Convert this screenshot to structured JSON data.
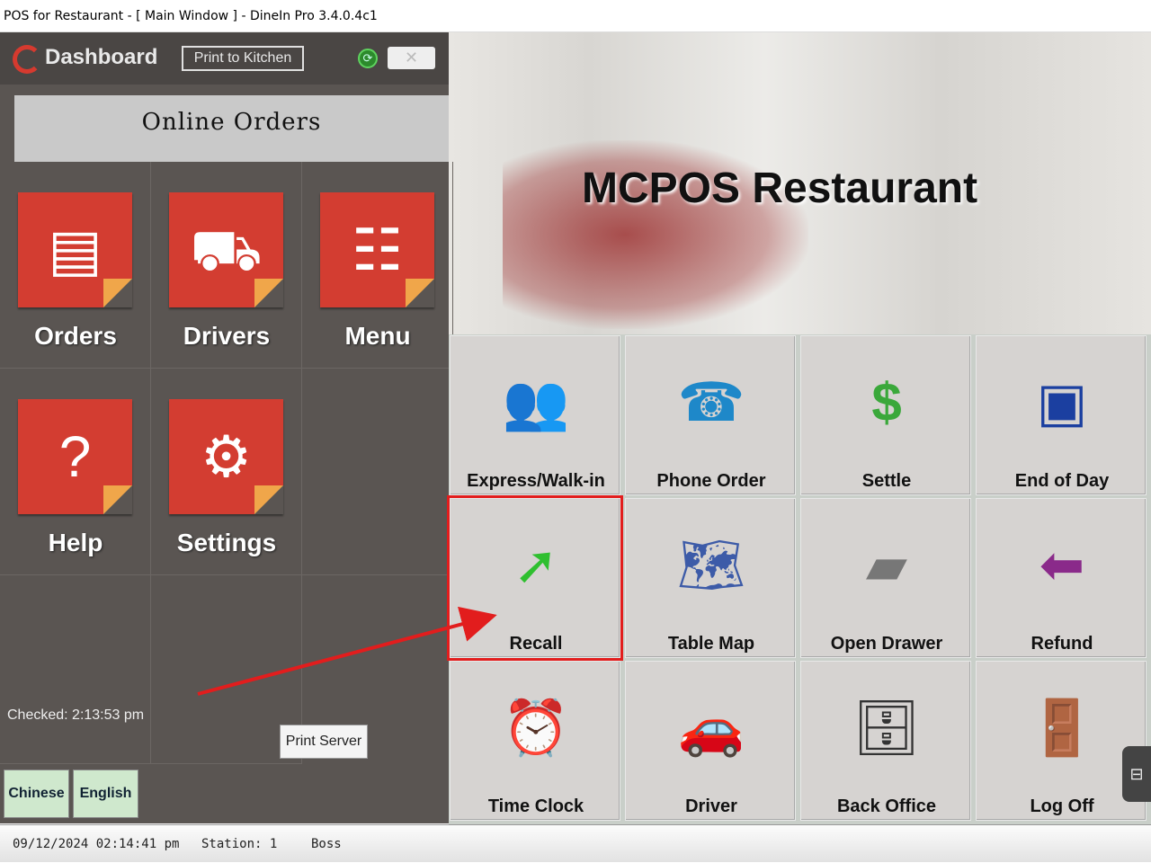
{
  "window": {
    "title": "POS for Restaurant - [ Main Window ] - DineIn Pro 3.4.0.4c1"
  },
  "dashboard": {
    "title": "Dashboard",
    "print_to_kitchen": "Print to Kitchen",
    "status_icon": "refresh-icon",
    "online_orders": "Online Orders",
    "tiles": [
      {
        "label": "Orders",
        "icon": "documents-icon"
      },
      {
        "label": "Drivers",
        "icon": "truck-icon"
      },
      {
        "label": "Menu",
        "icon": "list-icon"
      },
      {
        "label": "Help",
        "icon": "question-icon"
      },
      {
        "label": "Settings",
        "icon": "gear-icon"
      }
    ],
    "checked": "Checked: 2:13:53 pm",
    "print_server": "Print Server",
    "languages": [
      "Chinese",
      "English"
    ]
  },
  "brand": {
    "name": "MCPOS Restaurant"
  },
  "buttons": [
    {
      "label": "Express/Walk-in",
      "icon": "people-icon"
    },
    {
      "label": "Phone Order",
      "icon": "telephone-icon"
    },
    {
      "label": "Settle",
      "icon": "dollar-icon"
    },
    {
      "label": "End of Day",
      "icon": "night-dollar-icon"
    },
    {
      "label": "Recall",
      "icon": "green-arrow-icon"
    },
    {
      "label": "Table Map",
      "icon": "map-icon"
    },
    {
      "label": "Open Drawer",
      "icon": "cash-drawer-icon"
    },
    {
      "label": "Refund",
      "icon": "refund-icon"
    },
    {
      "label": "Time Clock",
      "icon": "clock-icon"
    },
    {
      "label": "Driver",
      "icon": "cars-icon"
    },
    {
      "label": "Back Office",
      "icon": "file-cabinet-icon"
    },
    {
      "label": "Log Off",
      "icon": "exit-door-icon"
    }
  ],
  "statusbar": {
    "datetime": "09/12/2024 02:14:41 pm",
    "station": "Station: 1",
    "user": "Boss"
  },
  "colors": {
    "tile_red": "#d33d31",
    "highlight": "#e21d1d",
    "panel": "#5a5552"
  }
}
